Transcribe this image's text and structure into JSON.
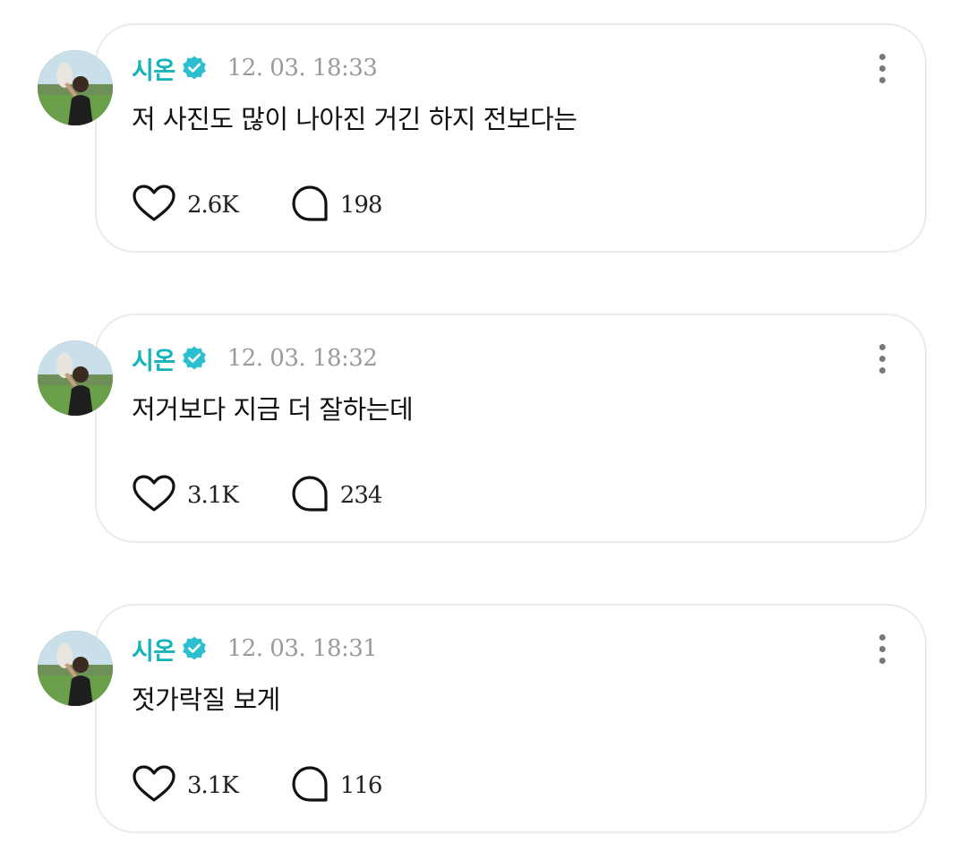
{
  "colors": {
    "username": "#16b3b8",
    "verified_badge": "#2bbfd0",
    "timestamp": "#9a9a9a",
    "card_border": "#ebebeb"
  },
  "posts": [
    {
      "username": "시온",
      "verified_icon": "verified-badge-icon",
      "timestamp": "12. 03. 18:33",
      "text": "저 사진도 많이 나아진 거긴 하지 전보다는",
      "likes": "2.6K",
      "comments": "198"
    },
    {
      "username": "시온",
      "verified_icon": "verified-badge-icon",
      "timestamp": "12. 03. 18:32",
      "text": "저거보다 지금 더 잘하는데",
      "likes": "3.1K",
      "comments": "234"
    },
    {
      "username": "시온",
      "verified_icon": "verified-badge-icon",
      "timestamp": "12. 03. 18:31",
      "text": "젓가락질 보게",
      "likes": "3.1K",
      "comments": "116"
    }
  ]
}
